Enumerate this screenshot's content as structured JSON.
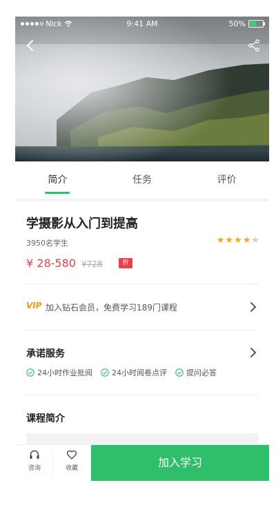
{
  "status_bar": {
    "carrier": "Nick",
    "time": "9:41 AM",
    "battery": "50%",
    "battery_level": 0.5,
    "battery_color": "#3bd16f"
  },
  "header": {
    "back_icon": "chevron-left-icon",
    "share_icon": "share-icon"
  },
  "tabs": [
    {
      "label": "简介",
      "active": true
    },
    {
      "label": "任务",
      "active": false
    },
    {
      "label": "评价",
      "active": false
    }
  ],
  "course": {
    "title": "学摄影从入门到提高",
    "students": "3950名学生",
    "rating": 4,
    "rating_max": 5,
    "price": "¥ 28-580",
    "original_price": "¥728",
    "discount_badge": "折"
  },
  "vip": {
    "badge": "VIP",
    "text": "加入钻石会员，免费学习189门课程"
  },
  "service": {
    "title": "承诺服务",
    "items": [
      "24小时作业批阅",
      "24小时阅卷点评",
      "提问必答"
    ]
  },
  "intro": {
    "title": "课程简介"
  },
  "bottom_bar": {
    "consult_label": "咨询",
    "favorite_label": "收藏",
    "join_label": "加入学习"
  },
  "colors": {
    "accent": "#2fbf6a",
    "price": "#ef3f4a",
    "star": "#ffa414",
    "vip": "#f39a1d"
  }
}
